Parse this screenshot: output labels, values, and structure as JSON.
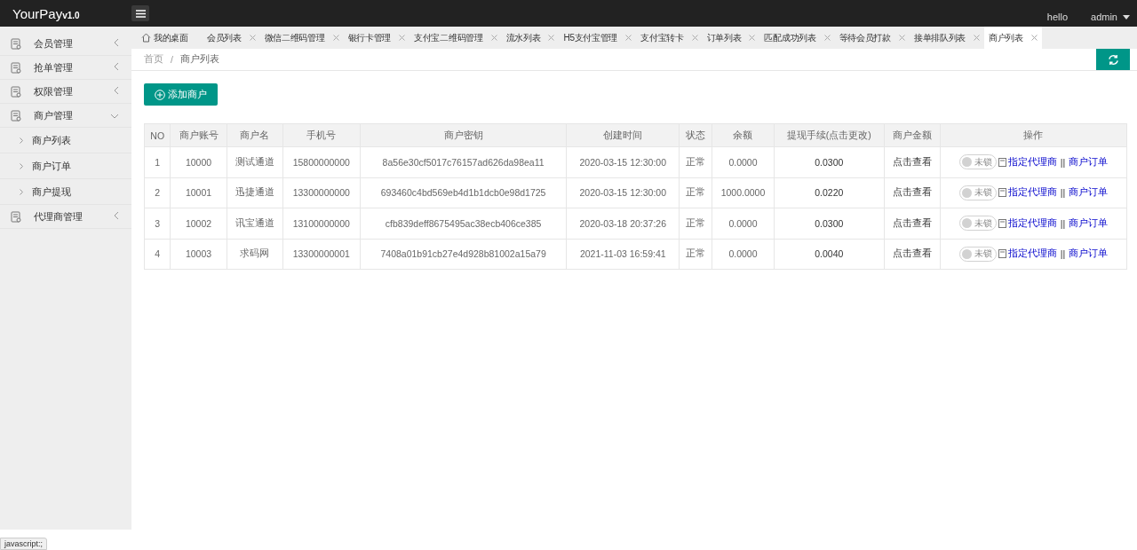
{
  "header": {
    "logo": "YourPay",
    "version": "v1.0",
    "greeting": "hello",
    "user": "admin"
  },
  "sidebar": {
    "items": [
      {
        "label": "会员管理",
        "expanded": false
      },
      {
        "label": "抢单管理",
        "expanded": false
      },
      {
        "label": "权限管理",
        "expanded": false
      },
      {
        "label": "商户管理",
        "expanded": true,
        "children": [
          {
            "label": "商户列表"
          },
          {
            "label": "商户订单"
          },
          {
            "label": "商户提现"
          }
        ]
      },
      {
        "label": "代理商管理",
        "expanded": false
      }
    ]
  },
  "tabs": [
    {
      "label": "我的桌面",
      "kind": "home",
      "selected": false
    },
    {
      "label": "会员列表",
      "kind": "closable",
      "selected": false
    },
    {
      "label": "微信二维码管理",
      "kind": "closable",
      "selected": false
    },
    {
      "label": "银行卡管理",
      "kind": "closable",
      "selected": false
    },
    {
      "label": "支付宝二维码管理",
      "kind": "closable",
      "selected": false
    },
    {
      "label": "流水列表",
      "kind": "closable",
      "selected": false
    },
    {
      "label": "H5支付宝管理",
      "kind": "closable",
      "selected": false
    },
    {
      "label": "支付宝转卡",
      "kind": "closable",
      "selected": false
    },
    {
      "label": "订单列表",
      "kind": "closable",
      "selected": false
    },
    {
      "label": "匹配成功列表",
      "kind": "closable",
      "selected": false
    },
    {
      "label": "等待会员打款",
      "kind": "closable",
      "selected": false
    },
    {
      "label": "接单排队列表",
      "kind": "closable",
      "selected": false
    },
    {
      "label": "商户列表",
      "kind": "closable",
      "selected": true
    }
  ],
  "breadcrumb": [
    "首页",
    "/",
    "商户列表"
  ],
  "add_button": "添加商户",
  "table": {
    "columns": [
      "NO",
      "商户账号",
      "商户名",
      "手机号",
      "商户密钥",
      "创建时间",
      "状态",
      "余额",
      "提现手续(点击更改)",
      "商户金额",
      "操作"
    ],
    "rows": [
      {
        "no": "1",
        "account": "10000",
        "name": "测试通道",
        "phone": "15800000000",
        "key": "8a56e30cf5017c76157ad626da98ea11",
        "created": "2020-03-15 12:30:00",
        "status": "正常",
        "balance": "0.0000",
        "fee": "0.0300",
        "amount": "点击查看",
        "lock": {
          "label": "未锁",
          "on": false
        },
        "actions": [
          "指定代理商",
          "||",
          "商户订单"
        ]
      },
      {
        "no": "2",
        "account": "10001",
        "name": "迅捷通道",
        "phone": "13300000000",
        "key": "693460c4bd569eb4d1b1dcb0e98d1725",
        "created": "2020-03-15 12:30:00",
        "status": "正常",
        "balance": "1000.0000",
        "fee": "0.0220",
        "amount": "点击查看",
        "lock": {
          "label": "未锁",
          "on": false
        },
        "actions": [
          "指定代理商",
          "||",
          "商户订单"
        ]
      },
      {
        "no": "3",
        "account": "10002",
        "name": "讯宝通道",
        "phone": "13100000000",
        "key": "cfb839deff8675495ac38ecb406ce385",
        "created": "2020-03-18 20:37:26",
        "status": "正常",
        "balance": "0.0000",
        "fee": "0.0300",
        "amount": "点击查看",
        "lock": {
          "label": "未锁",
          "on": false
        },
        "actions": [
          "指定代理商",
          "||",
          "商户订单"
        ]
      },
      {
        "no": "4",
        "account": "10003",
        "name": "求码网",
        "phone": "13300000001",
        "key": "7408a01b91cb27e4d928b81002a15a79",
        "created": "2021-11-03 16:59:41",
        "status": "正常",
        "balance": "0.0000",
        "fee": "0.0040",
        "amount": "点击查看",
        "lock": {
          "label": "未锁",
          "on": false
        },
        "actions": [
          "指定代理商",
          "||",
          "商户订单"
        ]
      }
    ]
  },
  "status_bar": "javascript:;"
}
